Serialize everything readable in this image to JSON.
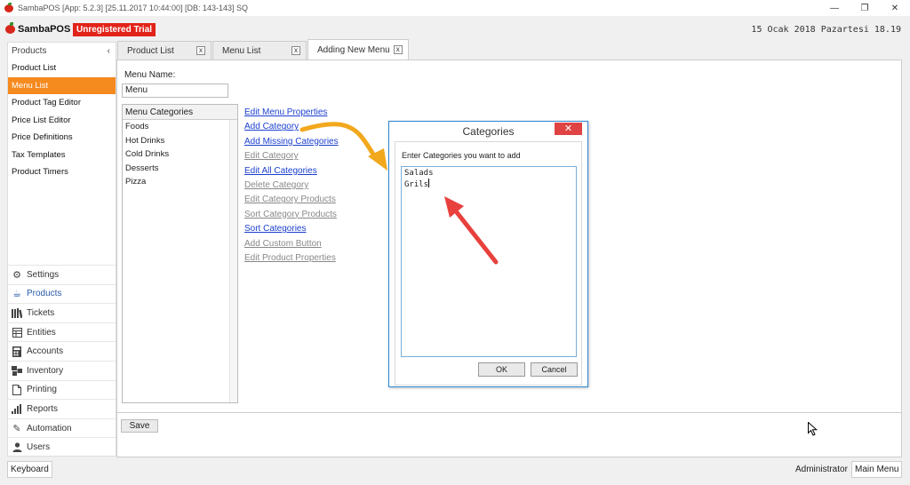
{
  "window": {
    "title": "SambaPOS [App: 5.2.3] [25.11.2017 10:44:00] [DB: 143-143] SQ",
    "controls": {
      "minimize": "—",
      "restore": "❐",
      "close": "✕"
    }
  },
  "brand": {
    "name": "SambaPOS",
    "trial_badge": "Unregistered Trial",
    "date": "15 Ocak 2018 Pazartesi 18.19"
  },
  "left_panel": {
    "header": "Products",
    "collapse_glyph": "‹",
    "items": [
      {
        "label": "Product List"
      },
      {
        "label": "Menu List"
      },
      {
        "label": "Product Tag Editor"
      },
      {
        "label": "Price List Editor"
      },
      {
        "label": "Price Definitions"
      },
      {
        "label": "Tax Templates"
      },
      {
        "label": "Product Timers"
      }
    ],
    "active_item": "Menu List",
    "nav": [
      {
        "label": "Settings",
        "icon": "gear-icon"
      },
      {
        "label": "Products",
        "icon": "coffee-icon"
      },
      {
        "label": "Tickets",
        "icon": "tickets-icon"
      },
      {
        "label": "Entities",
        "icon": "entities-icon"
      },
      {
        "label": "Accounts",
        "icon": "calculator-icon"
      },
      {
        "label": "Inventory",
        "icon": "inventory-icon"
      },
      {
        "label": "Printing",
        "icon": "document-icon"
      },
      {
        "label": "Reports",
        "icon": "bar-chart-icon"
      },
      {
        "label": "Automation",
        "icon": "pen-icon"
      },
      {
        "label": "Users",
        "icon": "user-icon"
      }
    ],
    "active_nav": "Products"
  },
  "tabs": [
    {
      "label": "Product List",
      "close": "x"
    },
    {
      "label": "Menu List",
      "close": "x"
    },
    {
      "label": "Adding New Menu",
      "close": "x"
    }
  ],
  "active_tab": "Adding New Menu",
  "editor": {
    "menu_name_label": "Menu Name:",
    "menu_name_value": "Menu",
    "categories_header": "Menu Categories",
    "categories": [
      "Foods",
      "Hot Drinks",
      "Cold Drinks",
      "Desserts",
      "Pizza"
    ],
    "actions": [
      {
        "label": "Edit Menu Properties",
        "enabled": true
      },
      {
        "label": "Add Category",
        "enabled": true
      },
      {
        "label": "Add Missing Categories",
        "enabled": true
      },
      {
        "label": "Edit Category",
        "enabled": false
      },
      {
        "label": "Edit All Categories",
        "enabled": true
      },
      {
        "label": "Delete Category",
        "enabled": false
      },
      {
        "label": "Edit Category Products",
        "enabled": false
      },
      {
        "label": "Sort Category Products",
        "enabled": false
      },
      {
        "label": "Sort Categories",
        "enabled": true
      },
      {
        "label": "Add Custom Button",
        "enabled": false
      },
      {
        "label": "Edit Product Properties",
        "enabled": false
      }
    ],
    "save_label": "Save"
  },
  "dialog": {
    "title": "Categories",
    "close_glyph": "✕",
    "prompt": "Enter Categories you want to add",
    "text_lines": [
      "Salads",
      "Grils"
    ],
    "ok_label": "OK",
    "cancel_label": "Cancel"
  },
  "annotations": {
    "orange_arrow_color": "#f2a81c",
    "red_arrow_color": "#e8413d"
  },
  "status": {
    "keyboard_label": "Keyboard",
    "user": "Administrator",
    "main_menu_label": "Main Menu"
  },
  "colors": {
    "accent_orange": "#f58a1f",
    "trial_red": "#e2231a",
    "link_blue": "#1a3fcf",
    "dialog_border": "#2f86d6"
  }
}
